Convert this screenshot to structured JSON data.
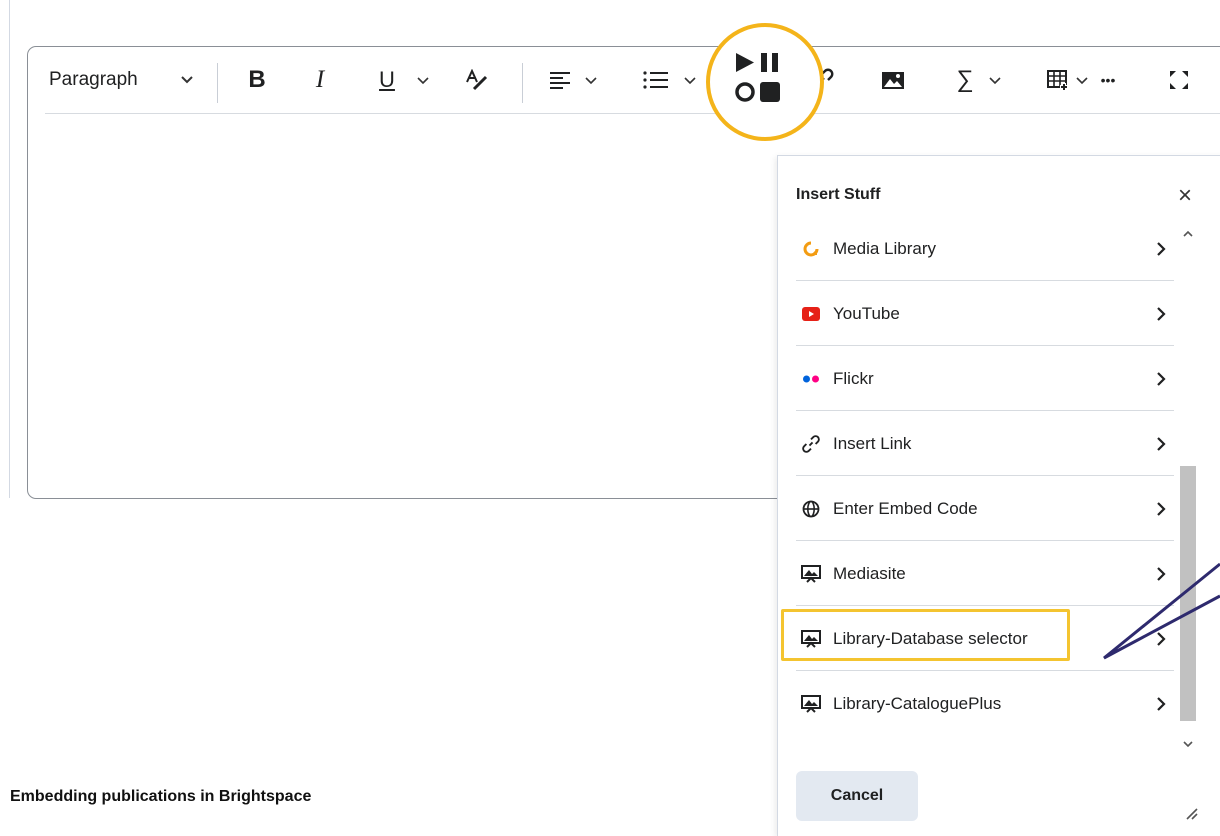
{
  "toolbar": {
    "paragraph_label": "Paragraph",
    "overflow_label": "•••"
  },
  "panel": {
    "title": "Insert Stuff",
    "items": [
      {
        "label": "Media Library",
        "icon": "media-library-icon"
      },
      {
        "label": "YouTube",
        "icon": "youtube-icon"
      },
      {
        "label": "Flickr",
        "icon": "flickr-icon"
      },
      {
        "label": "Insert Link",
        "icon": "link-icon"
      },
      {
        "label": "Enter Embed Code",
        "icon": "globe-icon"
      },
      {
        "label": "Mediasite",
        "icon": "presentation-icon"
      },
      {
        "label": "Library-Database selector",
        "icon": "presentation-icon"
      },
      {
        "label": "Library-CataloguePlus",
        "icon": "presentation-icon"
      }
    ],
    "cancel_label": "Cancel"
  },
  "caption": "Embedding publications in Brightspace",
  "colors": {
    "highlight": "#f4b41a",
    "selection_box": "#f4c430",
    "annotation_line": "#2e2a6e",
    "youtube": "#e62117",
    "media_library": "#f39c12",
    "flickr_blue": "#0063dc",
    "flickr_pink": "#ff0084"
  }
}
